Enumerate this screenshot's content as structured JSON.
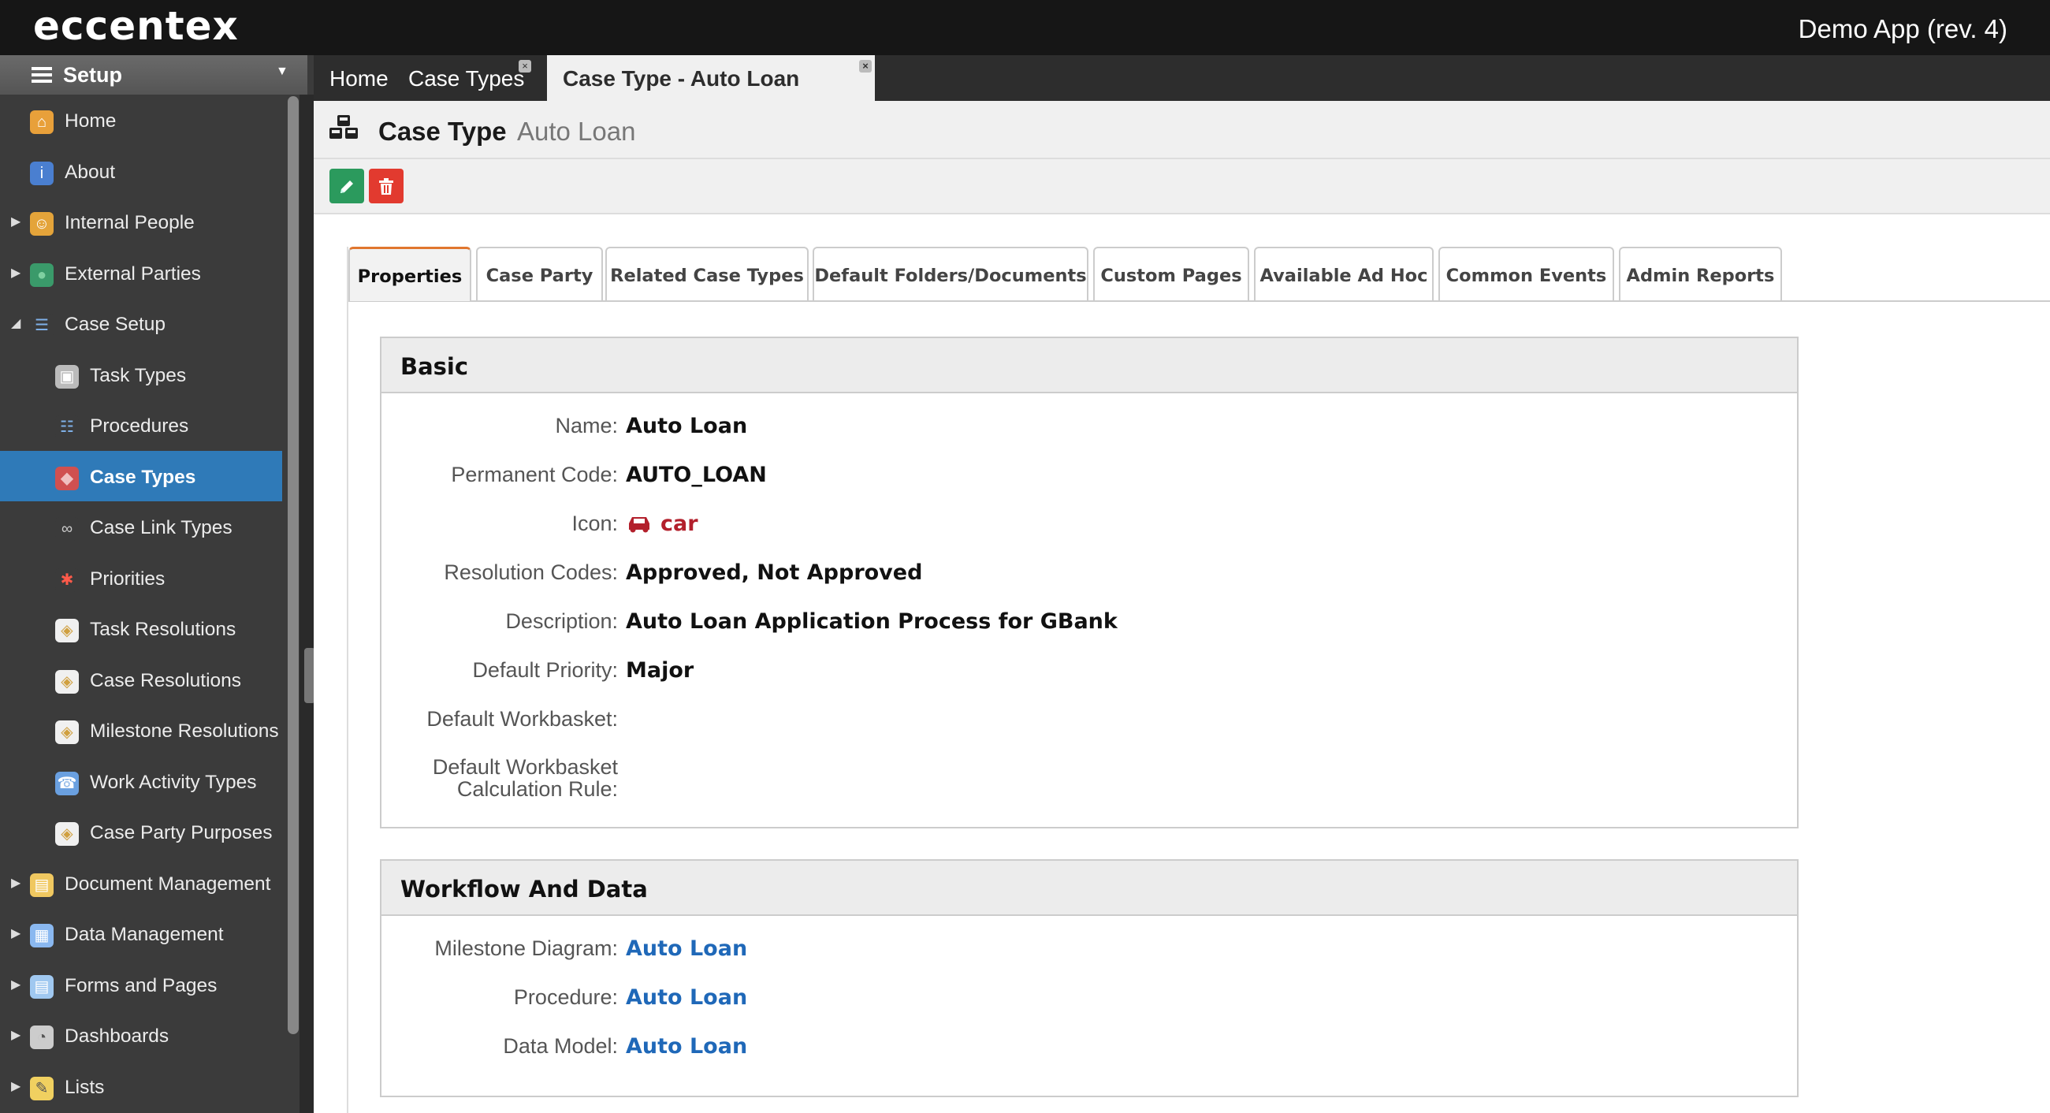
{
  "header": {
    "brand": "eccentex",
    "app_name": "Demo App (rev. 4)"
  },
  "sidebar": {
    "section_title": "Setup",
    "items": [
      {
        "label": "Home",
        "icon": "home-icon",
        "level": 0,
        "expandable": false,
        "active": false
      },
      {
        "label": "About",
        "icon": "info-icon",
        "level": 0,
        "expandable": false,
        "active": false
      },
      {
        "label": "Internal People",
        "icon": "people-icon",
        "level": 0,
        "expandable": true,
        "active": false
      },
      {
        "label": "External Parties",
        "icon": "globe-icon",
        "level": 0,
        "expandable": true,
        "active": false
      },
      {
        "label": "Case Setup",
        "icon": "case-setup-icon",
        "level": 0,
        "expandable": "open",
        "active": false
      },
      {
        "label": "Task Types",
        "icon": "task-types-icon",
        "level": 1,
        "expandable": false,
        "active": false
      },
      {
        "label": "Procedures",
        "icon": "procedures-icon",
        "level": 1,
        "expandable": false,
        "active": false
      },
      {
        "label": "Case Types",
        "icon": "case-types-icon",
        "level": 1,
        "expandable": false,
        "active": true
      },
      {
        "label": "Case Link Types",
        "icon": "link-icon",
        "level": 1,
        "expandable": false,
        "active": false
      },
      {
        "label": "Priorities",
        "icon": "asterisk-icon",
        "level": 1,
        "expandable": false,
        "active": false
      },
      {
        "label": "Task Resolutions",
        "icon": "tag-icon",
        "level": 1,
        "expandable": false,
        "active": false
      },
      {
        "label": "Case Resolutions",
        "icon": "tag-icon",
        "level": 1,
        "expandable": false,
        "active": false
      },
      {
        "label": "Milestone Resolutions",
        "icon": "tag-icon",
        "level": 1,
        "expandable": false,
        "active": false
      },
      {
        "label": "Work Activity Types",
        "icon": "phone-icon",
        "level": 1,
        "expandable": false,
        "active": false
      },
      {
        "label": "Case Party Purposes",
        "icon": "tag-icon",
        "level": 1,
        "expandable": false,
        "active": false
      },
      {
        "label": "Document Management",
        "icon": "folder-icon",
        "level": 0,
        "expandable": true,
        "active": false
      },
      {
        "label": "Data Management",
        "icon": "table-icon",
        "level": 0,
        "expandable": true,
        "active": false
      },
      {
        "label": "Forms and Pages",
        "icon": "form-icon",
        "level": 0,
        "expandable": true,
        "active": false
      },
      {
        "label": "Dashboards",
        "icon": "dashboard-icon",
        "level": 0,
        "expandable": true,
        "active": false
      },
      {
        "label": "Lists",
        "icon": "list-icon",
        "level": 0,
        "expandable": true,
        "active": false
      }
    ]
  },
  "page_tabs": [
    {
      "label": "Home",
      "closable": false,
      "active": false
    },
    {
      "label": "Case Types",
      "closable": true,
      "active": false
    },
    {
      "label": "Case Type - Auto Loan",
      "closable": true,
      "active": true
    }
  ],
  "title": {
    "main": "Case Type",
    "sub": "Auto Loan"
  },
  "content_tabs": [
    {
      "label": "Properties",
      "active": true
    },
    {
      "label": "Case Party",
      "active": false
    },
    {
      "label": "Related Case Types",
      "active": false
    },
    {
      "label": "Default Folders/Documents",
      "active": false
    },
    {
      "label": "Custom Pages",
      "active": false
    },
    {
      "label": "Available Ad Hoc",
      "active": false
    },
    {
      "label": "Common Events",
      "active": false
    },
    {
      "label": "Admin Reports",
      "active": false
    }
  ],
  "basic": {
    "heading": "Basic",
    "fields": [
      {
        "label": "Name:",
        "value": "Auto Loan"
      },
      {
        "label": "Permanent Code:",
        "value": "AUTO_LOAN"
      },
      {
        "label": "Icon:",
        "value": "car",
        "icon": "car-icon"
      },
      {
        "label": "Resolution Codes:",
        "value": "Approved, Not Approved"
      },
      {
        "label": "Description:",
        "value": "Auto Loan Application Process for GBank"
      },
      {
        "label": "Default Priority:",
        "value": "Major"
      },
      {
        "label": "Default Workbasket:",
        "value": ""
      },
      {
        "label": "Default Workbasket\nCalculation Rule:",
        "value": ""
      }
    ]
  },
  "workflow": {
    "heading": "Workflow And Data",
    "fields": [
      {
        "label": "Milestone Diagram:",
        "value": "Auto Loan"
      },
      {
        "label": "Procedure:",
        "value": "Auto Loan"
      },
      {
        "label": "Data Model:",
        "value": "Auto Loan"
      }
    ]
  },
  "colors": {
    "active_nav": "#2f7ab8",
    "link": "#1f68b8",
    "icon_red": "#b3202c",
    "edit": "#2b9a5d",
    "delete": "#e23a2f",
    "tab_accent": "#e0762e"
  }
}
